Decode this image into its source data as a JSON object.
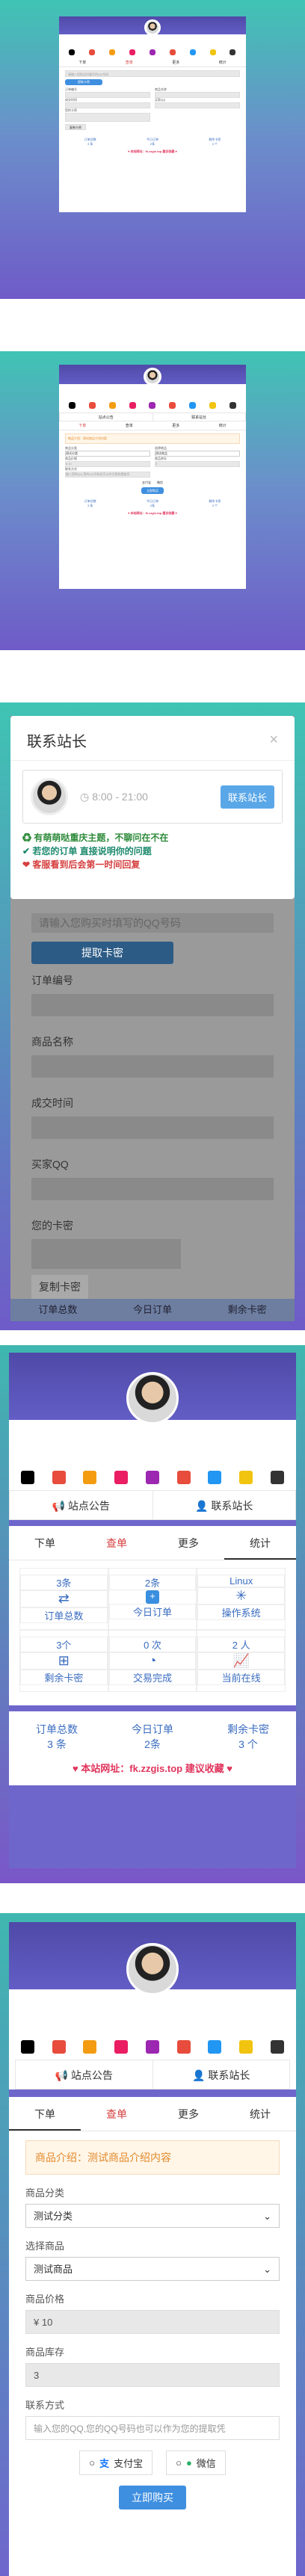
{
  "query": {
    "order_no_label": "订单编号",
    "product_label": "商品名称",
    "time_label": "成交时间",
    "qq_label": "买家QQ",
    "card_label": "您的卡密",
    "copy_btn": "复制卡密",
    "extract_btn": "提取卡密",
    "placeholder": "请输入您购买时填写的QQ号码"
  },
  "modal": {
    "title": "联系站长",
    "close": "×",
    "hours": "8:00 - 21:00",
    "contact_btn": "联系站长",
    "line1": "有萌萌哒重庆主题，不聊问在不在",
    "line2": "若您的订单 直接说明你的问题",
    "line3": "客服看到后会第一时间回复"
  },
  "nav": {
    "notice": "站点公告",
    "contact": "联系站长"
  },
  "tabs": {
    "order": "下单",
    "query": "查单",
    "more": "更多",
    "stats": "统计"
  },
  "stats": [
    {
      "value": "3条",
      "label": "订单总数"
    },
    {
      "value": "2条",
      "label": "今日订单"
    },
    {
      "value": "Linux",
      "label": "操作系统"
    },
    {
      "value": "3个",
      "label": "剩余卡密"
    },
    {
      "value": "0 次",
      "label": "交易完成"
    },
    {
      "value": "2 人",
      "label": "当前在线"
    }
  ],
  "footer": {
    "orders_label": "订单总数",
    "orders_value": "3 条",
    "today_label": "今日订单",
    "today_value": "2条",
    "left_label": "剩余卡密",
    "left_value": "3 个",
    "site_link": "♥ 本站网址：fk.zzgis.top 建议收藏 ♥"
  },
  "form": {
    "intro": "商品介绍：测试商品介绍内容",
    "category_label": "商品分类",
    "category_value": "测试分类",
    "product_label": "选择商品",
    "product_value": "测试商品",
    "price_label": "商品价格",
    "price_value": "¥ 10",
    "stock_label": "商品库存",
    "stock_value": "3",
    "contact_label": "联系方式",
    "contact_placeholder": "输入您的QQ,您的QQ号码也可以作为您的提取凭",
    "alipay": "支付宝",
    "wechat": "微信",
    "buy_btn": "立即购买"
  },
  "colors": {
    "accent": "#3f8fe0",
    "link": "#e0345c",
    "notice": "#e38a2c"
  }
}
